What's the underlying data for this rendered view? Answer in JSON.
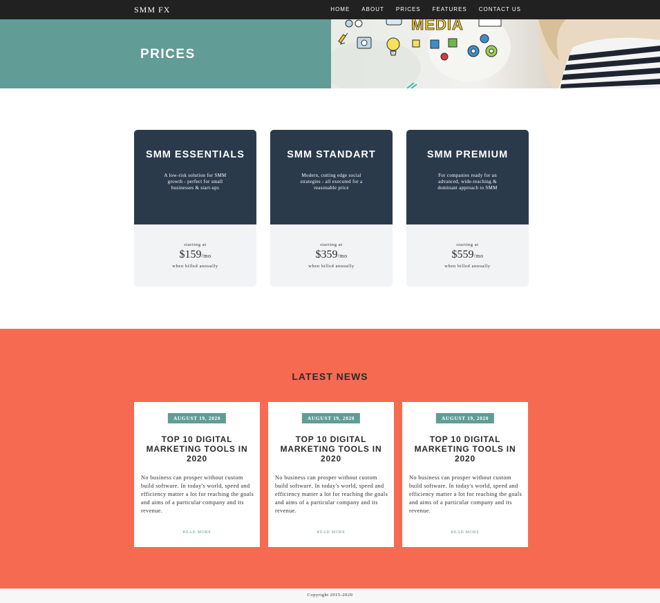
{
  "nav": {
    "logo": "SMM FX",
    "links": [
      "HOME",
      "ABOUT",
      "PRICES",
      "FEATURES",
      "CONTACT US"
    ]
  },
  "hero": {
    "title": "PRICES",
    "image_text": "MEDIA"
  },
  "pricing": {
    "cards": [
      {
        "title": "SMM ESSENTIALS",
        "description": "A low-risk solution for SMM growth - perfect for small businesses & start-ups",
        "starting": "starting at",
        "price": "$159",
        "period": "/mo",
        "billing": "when billed annually"
      },
      {
        "title": "SMM STANDART",
        "description": "Modern, cutting edge social strategies - all executed for a reasonable price",
        "starting": "starting at",
        "price": "$359",
        "period": "/mo",
        "billing": "when billed annually"
      },
      {
        "title": "SMM PREMIUM",
        "description": "For companies ready for an advanced, wide-reaching & dominant approach to SMM",
        "starting": "starting at",
        "price": "$559",
        "period": "/mo",
        "billing": "when billed annually"
      }
    ]
  },
  "news": {
    "heading": "LATEST NEWS",
    "items": [
      {
        "date": "AUGUST 19, 2020",
        "title": "TOP 10 DIGITAL MARKETING TOOLS IN 2020",
        "text": "No business can prosper without custom build software. In today's world, speed and efficiency matter a lot for reaching the goals and aims of a particular company and its revenue.",
        "read_more": "READ MORE"
      },
      {
        "date": "AUGUST 19, 2020",
        "title": "TOP 10 DIGITAL MARKETING TOOLS IN 2020",
        "text": "No business can prosper without custom build software. In today's world, speed and efficiency matter a lot for reaching the goals and aims of a particular company and its revenue.",
        "read_more": "READ MORE"
      },
      {
        "date": "AUGUST 19, 2020",
        "title": "TOP 10 DIGITAL MARKETING TOOLS IN 2020",
        "text": "No business can prosper without custom build software. In today's world, speed and efficiency matter a lot for reaching the goals and aims of a particular company and its revenue.",
        "read_more": "READ MORE"
      }
    ]
  },
  "footer": {
    "copyright": "Copyright 2015-2020"
  },
  "colors": {
    "nav_bg": "#212121",
    "teal": "#619c97",
    "card_dark": "#2b3a4b",
    "card_light": "#f2f3f5",
    "coral": "#f76a52",
    "footer_bg": "#f7f7f7"
  }
}
